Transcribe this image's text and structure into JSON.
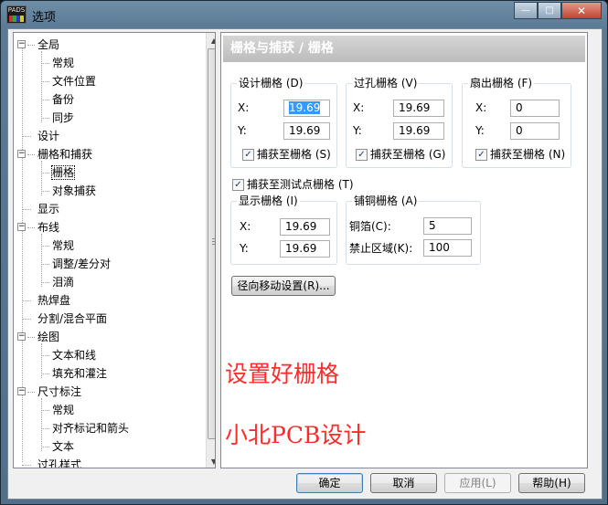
{
  "window": {
    "title": "选项",
    "app_icon_text": "PADS"
  },
  "caption": {
    "minimize": "—",
    "maximize": "□",
    "close": "✕"
  },
  "tree": {
    "items": [
      {
        "label": "全局",
        "expander": "−"
      },
      {
        "label": "常规"
      },
      {
        "label": "文件位置"
      },
      {
        "label": "备份"
      },
      {
        "label": "同步"
      },
      {
        "label": "设计"
      },
      {
        "label": "栅格和捕获",
        "expander": "−"
      },
      {
        "label": "栅格"
      },
      {
        "label": "对象捕获"
      },
      {
        "label": "显示"
      },
      {
        "label": "布线",
        "expander": "−"
      },
      {
        "label": "常规"
      },
      {
        "label": "调整/差分对"
      },
      {
        "label": "泪滴"
      },
      {
        "label": "热焊盘"
      },
      {
        "label": "分割/混合平面"
      },
      {
        "label": "绘图",
        "expander": "−"
      },
      {
        "label": "文本和线"
      },
      {
        "label": "填充和灌注"
      },
      {
        "label": "尺寸标注",
        "expander": "−"
      },
      {
        "label": "常规"
      },
      {
        "label": "对齐标记和箭头"
      },
      {
        "label": "文本"
      },
      {
        "label": "过孔样式"
      }
    ]
  },
  "panel": {
    "header": "栅格与捕获 / 栅格",
    "design_grid": {
      "title": "设计栅格 (D)",
      "x_label": "X:",
      "x_value": "19.69",
      "y_label": "Y:",
      "y_value": "19.69",
      "snap_label": "捕获至栅格 (S)",
      "snap_checked": "✓"
    },
    "via_grid": {
      "title": "过孔栅格 (V)",
      "x_label": "X:",
      "x_value": "19.69",
      "y_label": "Y:",
      "y_value": "19.69",
      "snap_label": "捕获至栅格 (G)",
      "snap_checked": "✓"
    },
    "fanout_grid": {
      "title": "扇出栅格 (F)",
      "x_label": "X:",
      "x_value": "0",
      "y_label": "Y:",
      "y_value": "0",
      "snap_label": "捕获至栅格 (N)",
      "snap_checked": "✓"
    },
    "testpoint_snap": {
      "label": "捕获至测试点栅格 (T)",
      "checked": "✓"
    },
    "display_grid": {
      "title": "显示栅格 (I)",
      "x_label": "X:",
      "x_value": "19.69",
      "y_label": "Y:",
      "y_value": "19.69"
    },
    "copper_grid": {
      "title": "铺铜栅格 (A)",
      "foil_label": "铜箔(C):",
      "foil_value": "5",
      "keepout_label": "禁止区域(K):",
      "keepout_value": "100"
    },
    "radial_move_button": "径向移动设置(R)...",
    "annotation_1": "设置好栅格",
    "annotation_2": "小北PCB设计"
  },
  "buttons": {
    "ok": "确定",
    "cancel": "取消",
    "apply": "应用(L)",
    "help": "帮助(H)"
  },
  "colors": {
    "annotation": "#ff2a2a",
    "panel_header": "#c8c8c8",
    "selection": "#3399ff"
  }
}
